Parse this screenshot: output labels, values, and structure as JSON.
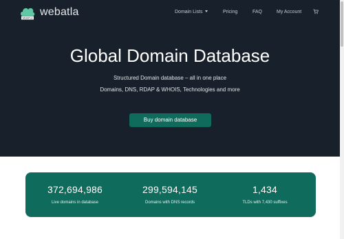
{
  "brand": {
    "name": "webatla",
    "logo_caption": "WEBATLA",
    "logo": "cloud-logo-icon"
  },
  "nav": {
    "domain_lists": "Domain Lists",
    "pricing": "Pricing",
    "faq": "FAQ",
    "account": "My Account",
    "cart_icon": "cart-icon"
  },
  "hero": {
    "title": "Global Domain Database",
    "subtitle1": "Structured Domain database – all in one place",
    "subtitle2": "Domains, DNS, RDAP & WHOIS, Technologies and more",
    "cta_label": "Buy domain database"
  },
  "stats": [
    {
      "value": "372,694,986",
      "label": "Live domains in database"
    },
    {
      "value": "299,594,145",
      "label": "Domains with DNS records"
    },
    {
      "value": "1,434",
      "label": "TLDs with 7,430 suffixes"
    }
  ],
  "colors": {
    "hero_bg": "#18212b",
    "accent": "#0f6b5b",
    "text_light": "#ffffff"
  }
}
